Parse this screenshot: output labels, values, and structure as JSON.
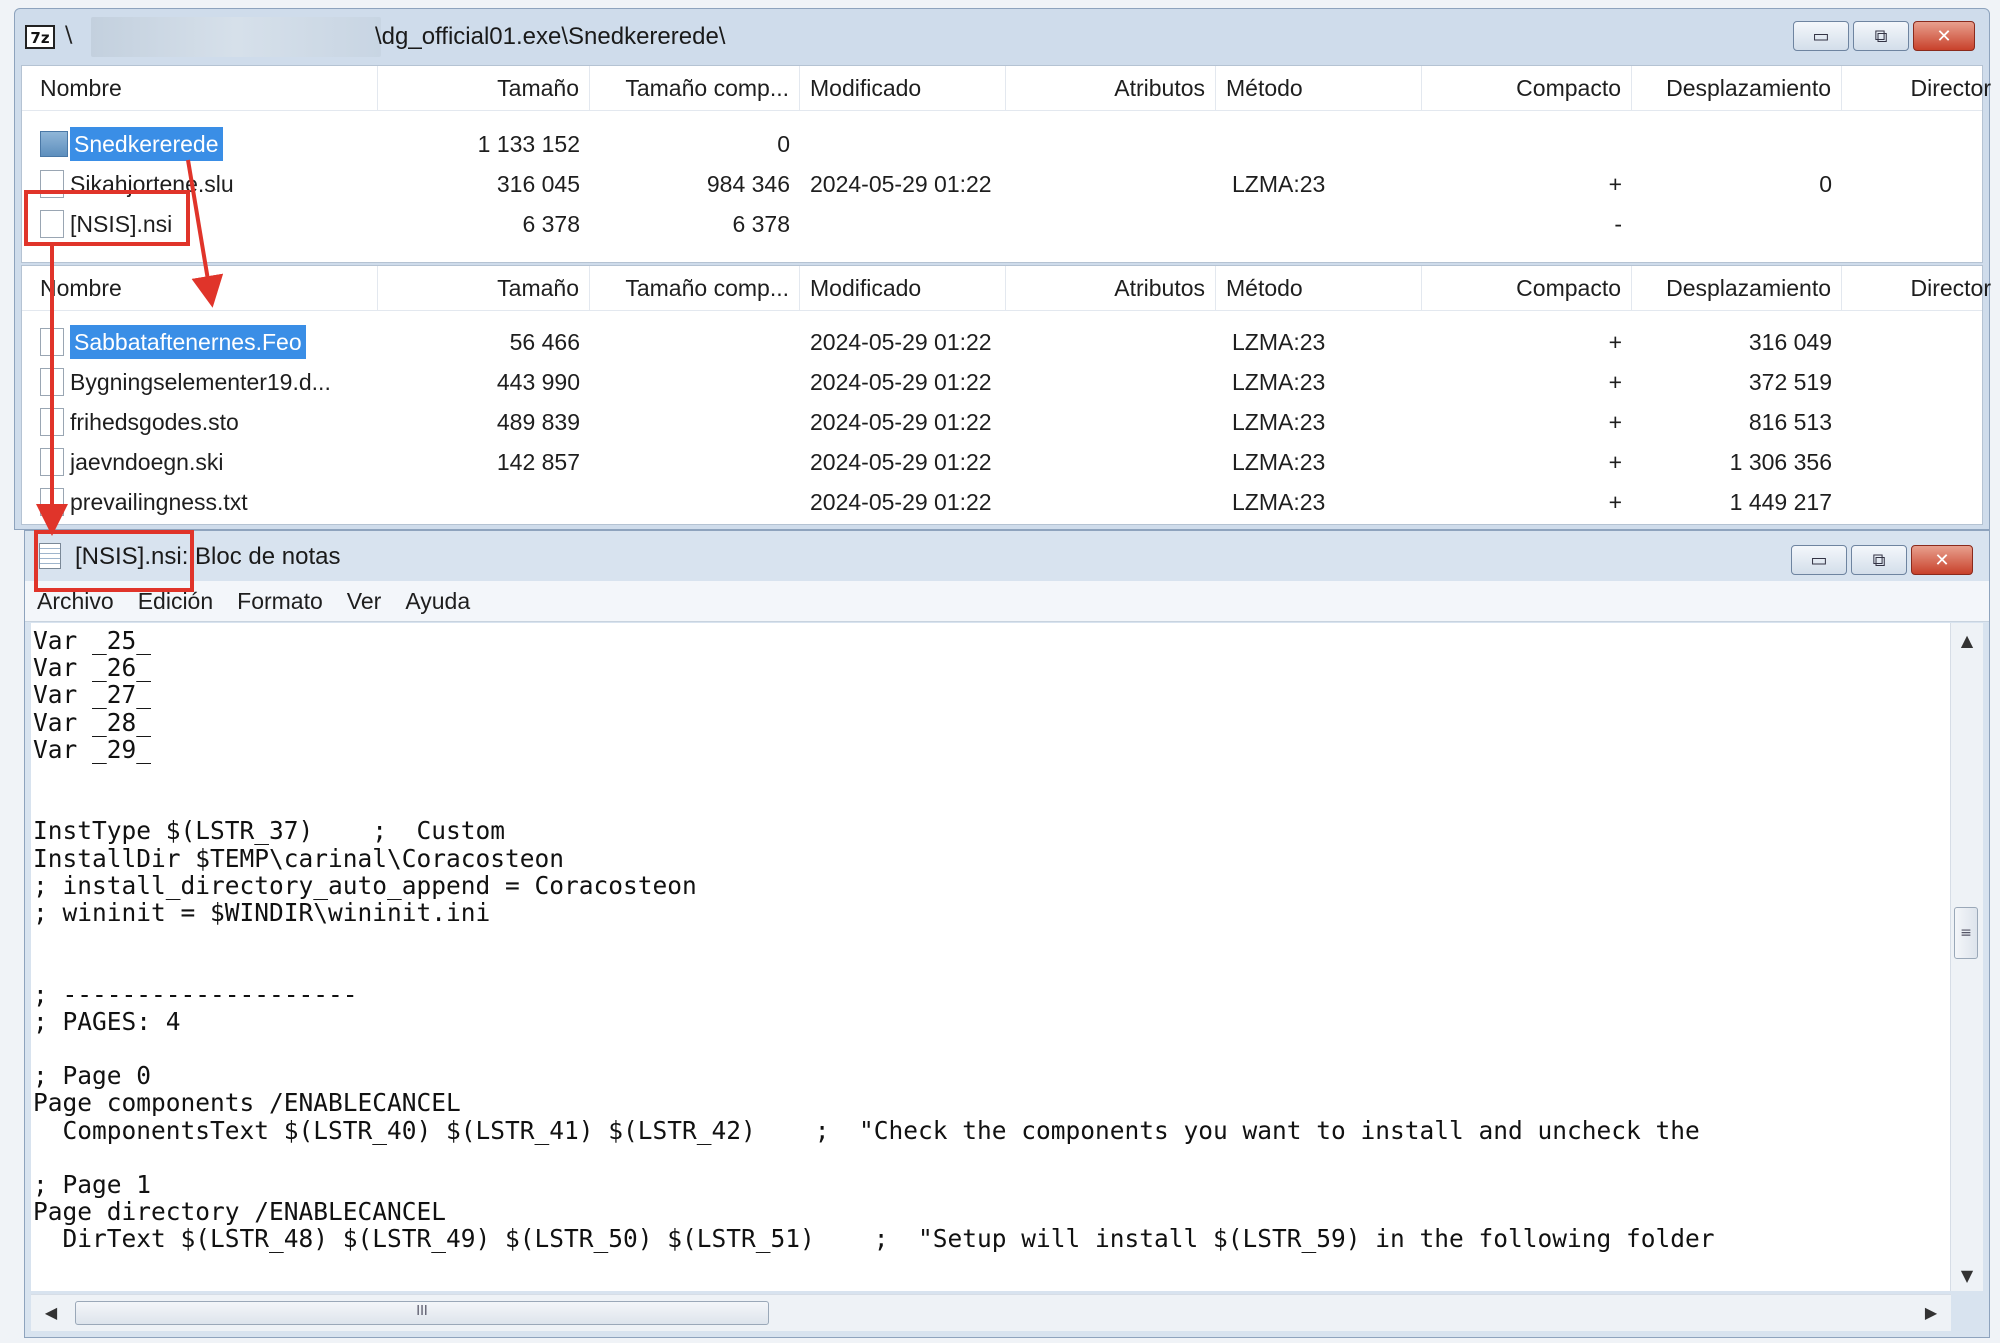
{
  "sevenzip": {
    "logo": "7z",
    "path_sep": "\\",
    "path": "\\dg_official01.exe\\Snedkererede\\",
    "columns": [
      "Nombre",
      "Tamaño",
      "Tamaño comp...",
      "Modificado",
      "Atributos",
      "Método",
      "Compacto",
      "Desplazamiento",
      "Director"
    ],
    "top_rows": [
      {
        "name": "Snedkererede",
        "size": "1 133 152",
        "packed": "0",
        "modified": "",
        "method": "",
        "compact": "",
        "offset": "",
        "icon": "folder-icon",
        "selected": true
      },
      {
        "name": "Sikahjortene.slu",
        "size": "316 045",
        "packed": "984 346",
        "modified": "2024-05-29 01:22",
        "method": "LZMA:23",
        "compact": "+",
        "offset": "0",
        "icon": "file-icon",
        "selected": false
      },
      {
        "name": "[NSIS].nsi",
        "size": "6 378",
        "packed": "6 378",
        "modified": "",
        "method": "",
        "compact": "-",
        "offset": "",
        "icon": "file-icon",
        "selected": false
      }
    ],
    "bottom_rows": [
      {
        "name": "Sabbataftenernes.Feo",
        "size": "56 466",
        "packed": "",
        "modified": "2024-05-29 01:22",
        "method": "LZMA:23",
        "compact": "+",
        "offset": "316 049",
        "icon": "file-icon",
        "selected": true
      },
      {
        "name": "Bygningselementer19.d...",
        "size": "443 990",
        "packed": "",
        "modified": "2024-05-29 01:22",
        "method": "LZMA:23",
        "compact": "+",
        "offset": "372 519",
        "icon": "file-icon",
        "selected": false
      },
      {
        "name": "frihedsgodes.sto",
        "size": "489 839",
        "packed": "",
        "modified": "2024-05-29 01:22",
        "method": "LZMA:23",
        "compact": "+",
        "offset": "816 513",
        "icon": "file-icon",
        "selected": false
      },
      {
        "name": "jaevndoegn.ski",
        "size": "142 857",
        "packed": "",
        "modified": "2024-05-29 01:22",
        "method": "LZMA:23",
        "compact": "+",
        "offset": "1 306 356",
        "icon": "file-icon",
        "selected": false
      },
      {
        "name": "prevailingness.txt",
        "size": "",
        "packed": "",
        "modified": "2024-05-29 01:22",
        "method": "LZMA:23",
        "compact": "+",
        "offset": "1 449 217",
        "icon": "file-icon",
        "selected": false
      }
    ],
    "buttons": {
      "minimize": "▭",
      "maximize": "⧉",
      "close": "✕"
    }
  },
  "notepad": {
    "title": "[NSIS].nsi: Bloc de notas",
    "menu": [
      "Archivo",
      "Edición",
      "Formato",
      "Ver",
      "Ayuda"
    ],
    "content": "Var _25_\nVar _26_\nVar _27_\nVar _28_\nVar _29_\n\n\nInstType $(LSTR_37)    ;  Custom\nInstallDir $TEMP\\carinal\\Coracosteon\n; install_directory_auto_append = Coracosteon\n; wininit = $WINDIR\\wininit.ini\n\n\n; --------------------\n; PAGES: 4\n\n; Page 0\nPage components /ENABLECANCEL\n  ComponentsText $(LSTR_40) $(LSTR_41) $(LSTR_42)    ;  \"Check the components you want to install and uncheck the\n\n; Page 1\nPage directory /ENABLECANCEL\n  DirText $(LSTR_48) $(LSTR_49) $(LSTR_50) $(LSTR_51)    ;  \"Setup will install $(LSTR_59) in the following folder",
    "buttons": {
      "minimize": "▭",
      "maximize": "⧉",
      "close": "✕"
    },
    "scroll_glyphs": {
      "up": "▲",
      "down": "▼",
      "left": "◀",
      "right": "▶",
      "grip": "≡",
      "hgrip": "III"
    }
  },
  "colors": {
    "annotation_red": "#e0342a",
    "selection_blue": "#3a8ee6"
  }
}
